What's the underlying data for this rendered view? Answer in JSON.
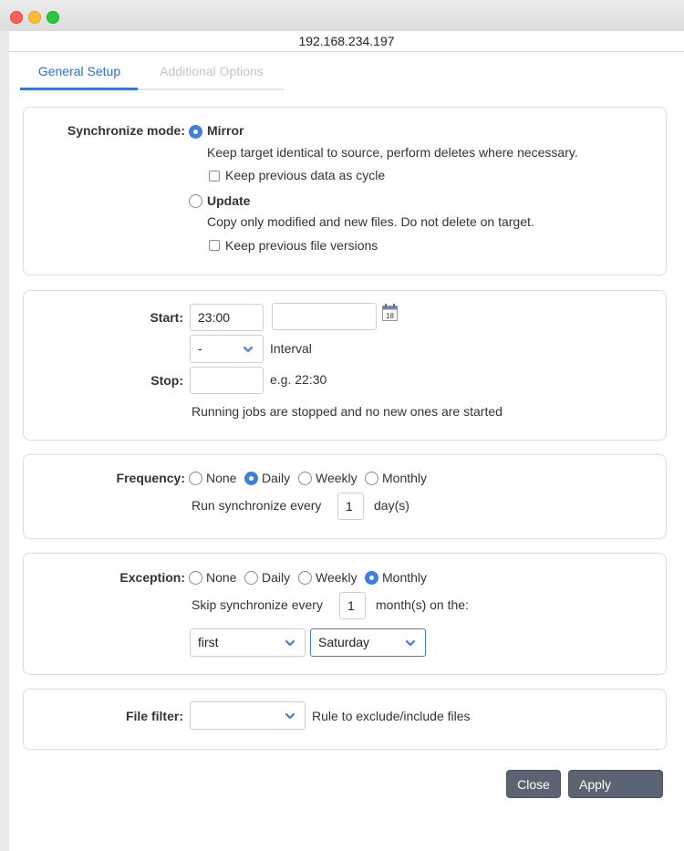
{
  "window": {
    "address": "192.168.234.197"
  },
  "tabs": {
    "general": "General Setup",
    "additional": "Additional Options"
  },
  "sync": {
    "label": "Synchronize mode:",
    "mirror_label": "Mirror",
    "mirror_desc": "Keep target identical to source, perform deletes where necessary.",
    "mirror_check": "Keep previous data as cycle",
    "update_label": "Update",
    "update_desc": "Copy only modified and new files. Do not delete on target.",
    "update_check": "Keep previous file versions"
  },
  "schedule": {
    "start_label": "Start:",
    "start_value": "23:00",
    "date_value": "",
    "calendar_icon": "calendar-icon",
    "calendar_day": "18",
    "interval_value": "-",
    "interval_label": "Interval",
    "stop_label": "Stop:",
    "stop_value": "",
    "stop_hint": "e.g. 22:30",
    "stop_note": "Running jobs are stopped and no new ones are started"
  },
  "frequency": {
    "label": "Frequency:",
    "options": [
      "None",
      "Daily",
      "Weekly",
      "Monthly"
    ],
    "selected": "Daily",
    "run_prefix": "Run synchronize every",
    "run_value": "1",
    "run_suffix": "day(s)"
  },
  "exception": {
    "label": "Exception:",
    "options": [
      "None",
      "Daily",
      "Weekly",
      "Monthly"
    ],
    "selected": "Monthly",
    "skip_prefix": "Skip synchronize every",
    "skip_value": "1",
    "skip_suffix": "month(s) on the:",
    "week_value": "first",
    "day_value": "Saturday"
  },
  "filter": {
    "label": "File filter:",
    "value": "",
    "desc": "Rule to exclude/include files"
  },
  "buttons": {
    "close": "Close",
    "apply": "Apply"
  },
  "colors": {
    "accent": "#3d7ee0",
    "button": "#5b6473"
  }
}
